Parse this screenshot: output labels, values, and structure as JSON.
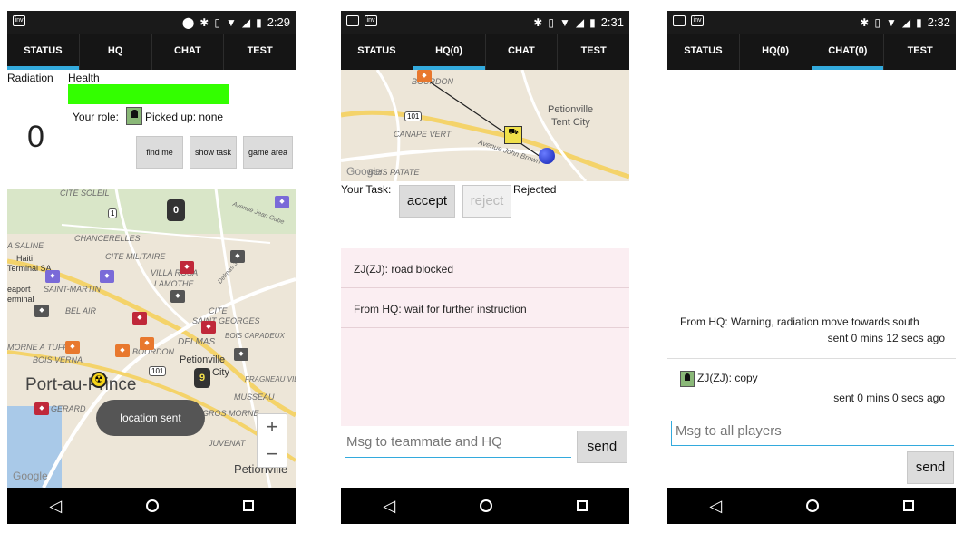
{
  "screens": [
    {
      "status": {
        "time": "2:29"
      },
      "tabs": [
        "STATUS",
        "HQ",
        "CHAT",
        "TEST"
      ],
      "labels": {
        "radiation": "Radiation",
        "health": "Health",
        "radiation_value": "0",
        "role_label": "Your role:",
        "picked_up": "Picked up: none"
      },
      "buttons": [
        "find me",
        "show task",
        "game area"
      ],
      "map": {
        "places": [
          "CITE SOLEIL",
          "CHANCERELLES",
          "A SALINE",
          "Haiti",
          "Terminal SA",
          "eaport",
          "erminal",
          "CITE MILITAIRE",
          "SAINT-MARTIN",
          "VILLA ROSA",
          "LAMOTHE",
          "BEL AIR",
          "CITE",
          "SAINT GEORGES",
          "DELMAS",
          "BOIS CARADEUX",
          "MORNE A TUFF",
          "BOIS VERNA",
          "BOURDON",
          "Petionville",
          "City",
          "FRAGNEAU VIL",
          "MUSSEAU",
          "GROS MORNE",
          "JUVENAT",
          "Port-au-Prince",
          "GERARD",
          "Petionville",
          "Avenue Jean Gabe",
          "Delmas 33",
          "1",
          "101"
        ],
        "google": "Google",
        "toast": "location sent",
        "zoom_in": "+",
        "zoom_out": "−",
        "badges": [
          "0",
          "9"
        ]
      }
    },
    {
      "status": {
        "time": "2:31"
      },
      "tabs": [
        "STATUS",
        "HQ(0)",
        "CHAT",
        "TEST"
      ],
      "map": {
        "places": [
          "BOURDON",
          "Petionville",
          "Tent City",
          "CANAPE VERT",
          "Avenue John Brown",
          "BOIS PATATE",
          "101"
        ],
        "google": "Google"
      },
      "task_label": "Your Task:",
      "accept": "accept",
      "reject": "reject",
      "rejected": "Rejected",
      "messages": [
        "ZJ(ZJ): road blocked",
        "From HQ: wait for further instruction"
      ],
      "input_placeholder": "Msg to teammate and HQ",
      "send": "send"
    },
    {
      "status": {
        "time": "2:32"
      },
      "tabs": [
        "STATUS",
        "HQ(0)",
        "CHAT(0)",
        "TEST"
      ],
      "messages": [
        {
          "text": "From HQ: Warning, radiation move towards south",
          "time": "sent 0 mins 12 secs ago"
        },
        {
          "text": "ZJ(ZJ): copy",
          "time": "sent 0 mins 0 secs ago"
        }
      ],
      "input_placeholder": "Msg to all players",
      "send": "send"
    }
  ],
  "colors": {
    "accent": "#33aadd",
    "health": "#33ff00",
    "chat_bg": "#fbeef2"
  }
}
